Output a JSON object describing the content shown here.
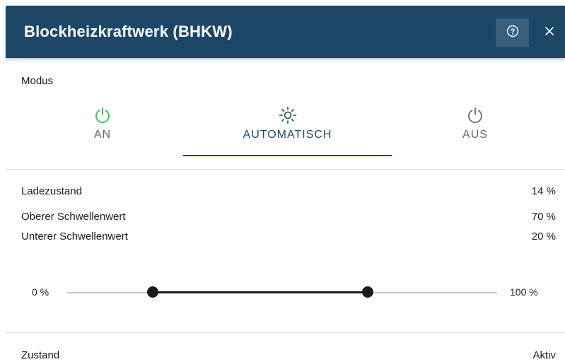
{
  "header": {
    "title": "Blockheizkraftwerk (BHKW)",
    "help_icon": "help-circle-icon",
    "close_icon": "close-icon"
  },
  "mode": {
    "label": "Modus",
    "tabs": [
      {
        "label": "AN",
        "icon": "power-icon",
        "icon_color": "#3cc65a"
      },
      {
        "label": "AUTOMATISCH",
        "icon": "sun-icon",
        "icon_color": "#1d4767",
        "selected": true
      },
      {
        "label": "AUS",
        "icon": "power-icon",
        "icon_color": "#777777"
      }
    ]
  },
  "values": {
    "ladezustand": {
      "label": "Ladezustand",
      "value": "14 %"
    },
    "oberer": {
      "label": "Oberer Schwellenwert",
      "value": "70 %"
    },
    "unterer": {
      "label": "Unterer Schwellenwert",
      "value": "20 %"
    }
  },
  "slider": {
    "min_label": "0 %",
    "max_label": "100 %",
    "lower_value": 20,
    "upper_value": 70
  },
  "status": {
    "label": "Zustand",
    "value": "Aktiv"
  },
  "colors": {
    "header_bg": "#1d4767",
    "accent": "#1d4767",
    "on_green": "#3cc65a"
  }
}
